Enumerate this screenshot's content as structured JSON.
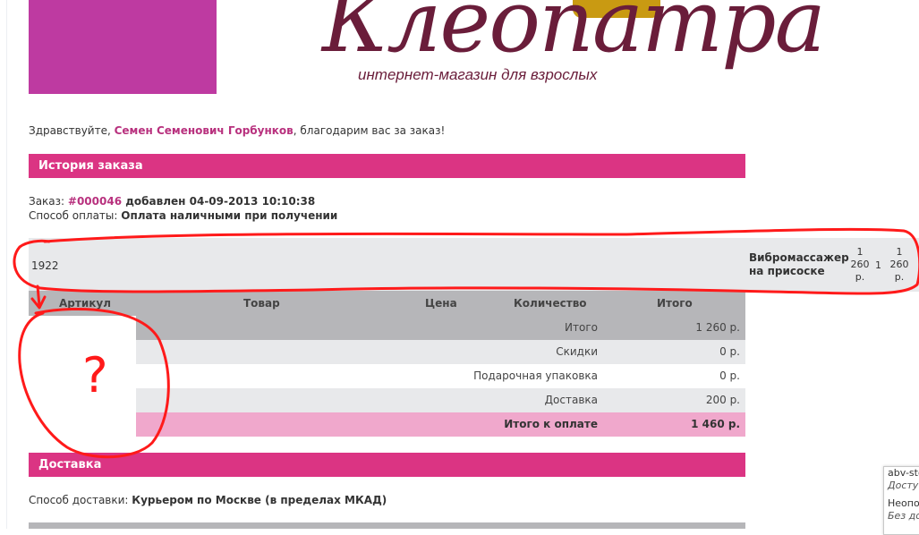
{
  "header": {
    "logo_script": "Клеопатра",
    "logo_tagline": "интернет-магазин для взрослых"
  },
  "greeting": {
    "prefix": "Здравствуйте, ",
    "name": "Семен Семенович Горбунков",
    "suffix": ", благодарим вас за заказ!"
  },
  "order_history": {
    "title": "История заказа",
    "order_label": "Заказ: ",
    "order_id": "#000046",
    "added_text": " добавлен 04-09-2013 10:10:38",
    "payment_label": "Способ оплаты: ",
    "payment_value": "Оплата наличными при получении"
  },
  "misplaced_row": {
    "article": "1922",
    "product": "Вибромассажер на присоске",
    "price_lines": [
      "1",
      "260",
      "р."
    ],
    "quantity": "1",
    "total_lines": [
      "1",
      "260",
      "р."
    ]
  },
  "table": {
    "headers": [
      "Артикул",
      "Товар",
      "Цена",
      "Количество",
      "Итого"
    ],
    "summary": [
      {
        "label": "Итого",
        "value": "1 260 р."
      },
      {
        "label": "Скидки",
        "value": "0 р."
      },
      {
        "label": "Подарочная упаковка",
        "value": "0 р."
      },
      {
        "label": "Доставка",
        "value": "200 р."
      },
      {
        "label": "Итого к оплате",
        "value": "1 460 р."
      }
    ]
  },
  "doodle": {
    "question_mark": "?"
  },
  "delivery": {
    "title": "Доставка",
    "method_label": "Способ доставки: ",
    "method_value": "Курьером по Москве (в пределах МКАД)"
  },
  "side_popup": {
    "line1": "abv-sto",
    "line2": "Досту",
    "line3": "Неопо",
    "line4": "Без до"
  },
  "colors": {
    "brand_magenta": "#db3483",
    "logo_dark": "#6a1d3a",
    "summary_total_bg": "#f0a8cc",
    "annotation_red": "#ff1a1a"
  }
}
